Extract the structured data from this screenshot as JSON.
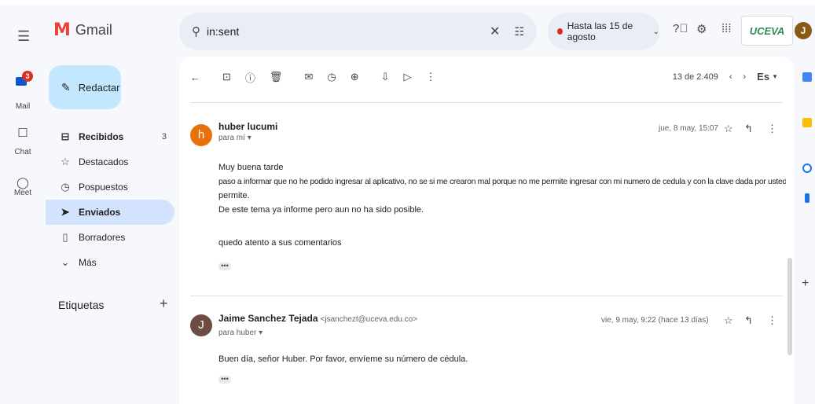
{
  "app": {
    "name": "Gmail"
  },
  "rail": {
    "mail_label": "Mail",
    "mail_badge": "3",
    "chat_label": "Chat",
    "meet_label": "Meet"
  },
  "compose": {
    "label": "Redactar"
  },
  "nav": {
    "items": [
      {
        "label": "Recibidos",
        "count": "3"
      },
      {
        "label": "Destacados"
      },
      {
        "label": "Pospuestos"
      },
      {
        "label": "Enviados"
      },
      {
        "label": "Borradores"
      },
      {
        "label": "Más"
      }
    ],
    "labels_heading": "Etiquetas"
  },
  "search": {
    "value": "in:sent"
  },
  "status": {
    "label": "Hasta las 15 de agosto"
  },
  "brand": {
    "text": "UCEVA"
  },
  "account": {
    "initial": "J"
  },
  "toolbar": {
    "pager": "13 de 2.409",
    "lang": "Es"
  },
  "messages": [
    {
      "avatar_initial": "h",
      "avatar_color": "#e8710a",
      "sender": "huber lucumi",
      "sender_email": "",
      "to": "para mí",
      "date": "jue, 8 may, 15:07",
      "body": [
        "Muy buena tarde",
        "paso a informar que no he podido ingresar al aplicativo, no se si me crearon mal porque no me permite ingresar con mi numero de cedula y con la clave dada por ustedes y no me",
        "permite.",
        "De este tema ya informe pero aun no ha sido posible.",
        "quedo atento a sus comentarios"
      ]
    },
    {
      "avatar_initial": "J",
      "avatar_color": "#6d4c41",
      "sender": "Jaime Sanchez Tejada",
      "sender_email": "<jsanchezt@uceva.edu.co>",
      "to": "para huber",
      "date": "vie, 9 may, 9:22 (hace 13 días)",
      "body": [
        "Buen día, señor Huber. Por favor, envíeme su número de cédula."
      ]
    }
  ],
  "colors": {
    "accent": "#0b57d0",
    "compose_bg": "#c2e7ff",
    "active_nav": "#d3e3fd"
  }
}
